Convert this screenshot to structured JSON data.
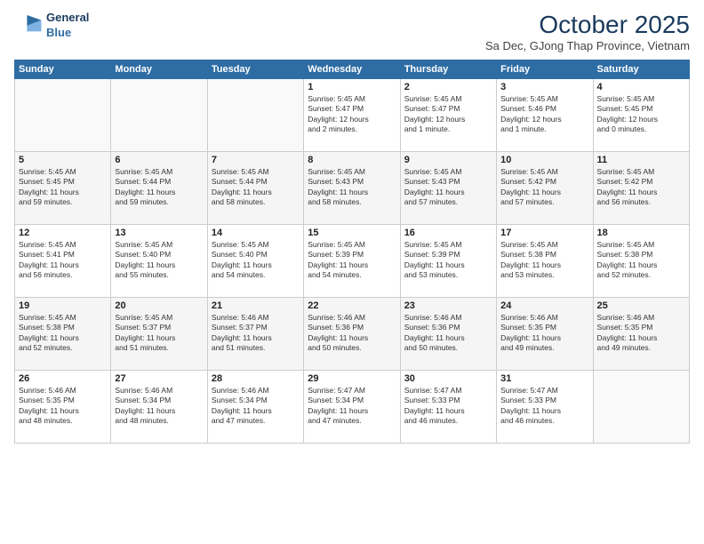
{
  "logo": {
    "line1": "General",
    "line2": "Blue"
  },
  "title": "October 2025",
  "subtitle": "Sa Dec, GJong Thap Province, Vietnam",
  "weekdays": [
    "Sunday",
    "Monday",
    "Tuesday",
    "Wednesday",
    "Thursday",
    "Friday",
    "Saturday"
  ],
  "weeks": [
    [
      {
        "day": "",
        "info": ""
      },
      {
        "day": "",
        "info": ""
      },
      {
        "day": "",
        "info": ""
      },
      {
        "day": "1",
        "info": "Sunrise: 5:45 AM\nSunset: 5:47 PM\nDaylight: 12 hours\nand 2 minutes."
      },
      {
        "day": "2",
        "info": "Sunrise: 5:45 AM\nSunset: 5:47 PM\nDaylight: 12 hours\nand 1 minute."
      },
      {
        "day": "3",
        "info": "Sunrise: 5:45 AM\nSunset: 5:46 PM\nDaylight: 12 hours\nand 1 minute."
      },
      {
        "day": "4",
        "info": "Sunrise: 5:45 AM\nSunset: 5:45 PM\nDaylight: 12 hours\nand 0 minutes."
      }
    ],
    [
      {
        "day": "5",
        "info": "Sunrise: 5:45 AM\nSunset: 5:45 PM\nDaylight: 11 hours\nand 59 minutes."
      },
      {
        "day": "6",
        "info": "Sunrise: 5:45 AM\nSunset: 5:44 PM\nDaylight: 11 hours\nand 59 minutes."
      },
      {
        "day": "7",
        "info": "Sunrise: 5:45 AM\nSunset: 5:44 PM\nDaylight: 11 hours\nand 58 minutes."
      },
      {
        "day": "8",
        "info": "Sunrise: 5:45 AM\nSunset: 5:43 PM\nDaylight: 11 hours\nand 58 minutes."
      },
      {
        "day": "9",
        "info": "Sunrise: 5:45 AM\nSunset: 5:43 PM\nDaylight: 11 hours\nand 57 minutes."
      },
      {
        "day": "10",
        "info": "Sunrise: 5:45 AM\nSunset: 5:42 PM\nDaylight: 11 hours\nand 57 minutes."
      },
      {
        "day": "11",
        "info": "Sunrise: 5:45 AM\nSunset: 5:42 PM\nDaylight: 11 hours\nand 56 minutes."
      }
    ],
    [
      {
        "day": "12",
        "info": "Sunrise: 5:45 AM\nSunset: 5:41 PM\nDaylight: 11 hours\nand 56 minutes."
      },
      {
        "day": "13",
        "info": "Sunrise: 5:45 AM\nSunset: 5:40 PM\nDaylight: 11 hours\nand 55 minutes."
      },
      {
        "day": "14",
        "info": "Sunrise: 5:45 AM\nSunset: 5:40 PM\nDaylight: 11 hours\nand 54 minutes."
      },
      {
        "day": "15",
        "info": "Sunrise: 5:45 AM\nSunset: 5:39 PM\nDaylight: 11 hours\nand 54 minutes."
      },
      {
        "day": "16",
        "info": "Sunrise: 5:45 AM\nSunset: 5:39 PM\nDaylight: 11 hours\nand 53 minutes."
      },
      {
        "day": "17",
        "info": "Sunrise: 5:45 AM\nSunset: 5:38 PM\nDaylight: 11 hours\nand 53 minutes."
      },
      {
        "day": "18",
        "info": "Sunrise: 5:45 AM\nSunset: 5:38 PM\nDaylight: 11 hours\nand 52 minutes."
      }
    ],
    [
      {
        "day": "19",
        "info": "Sunrise: 5:45 AM\nSunset: 5:38 PM\nDaylight: 11 hours\nand 52 minutes."
      },
      {
        "day": "20",
        "info": "Sunrise: 5:45 AM\nSunset: 5:37 PM\nDaylight: 11 hours\nand 51 minutes."
      },
      {
        "day": "21",
        "info": "Sunrise: 5:46 AM\nSunset: 5:37 PM\nDaylight: 11 hours\nand 51 minutes."
      },
      {
        "day": "22",
        "info": "Sunrise: 5:46 AM\nSunset: 5:36 PM\nDaylight: 11 hours\nand 50 minutes."
      },
      {
        "day": "23",
        "info": "Sunrise: 5:46 AM\nSunset: 5:36 PM\nDaylight: 11 hours\nand 50 minutes."
      },
      {
        "day": "24",
        "info": "Sunrise: 5:46 AM\nSunset: 5:35 PM\nDaylight: 11 hours\nand 49 minutes."
      },
      {
        "day": "25",
        "info": "Sunrise: 5:46 AM\nSunset: 5:35 PM\nDaylight: 11 hours\nand 49 minutes."
      }
    ],
    [
      {
        "day": "26",
        "info": "Sunrise: 5:46 AM\nSunset: 5:35 PM\nDaylight: 11 hours\nand 48 minutes."
      },
      {
        "day": "27",
        "info": "Sunrise: 5:46 AM\nSunset: 5:34 PM\nDaylight: 11 hours\nand 48 minutes."
      },
      {
        "day": "28",
        "info": "Sunrise: 5:46 AM\nSunset: 5:34 PM\nDaylight: 11 hours\nand 47 minutes."
      },
      {
        "day": "29",
        "info": "Sunrise: 5:47 AM\nSunset: 5:34 PM\nDaylight: 11 hours\nand 47 minutes."
      },
      {
        "day": "30",
        "info": "Sunrise: 5:47 AM\nSunset: 5:33 PM\nDaylight: 11 hours\nand 46 minutes."
      },
      {
        "day": "31",
        "info": "Sunrise: 5:47 AM\nSunset: 5:33 PM\nDaylight: 11 hours\nand 46 minutes."
      },
      {
        "day": "",
        "info": ""
      }
    ]
  ]
}
